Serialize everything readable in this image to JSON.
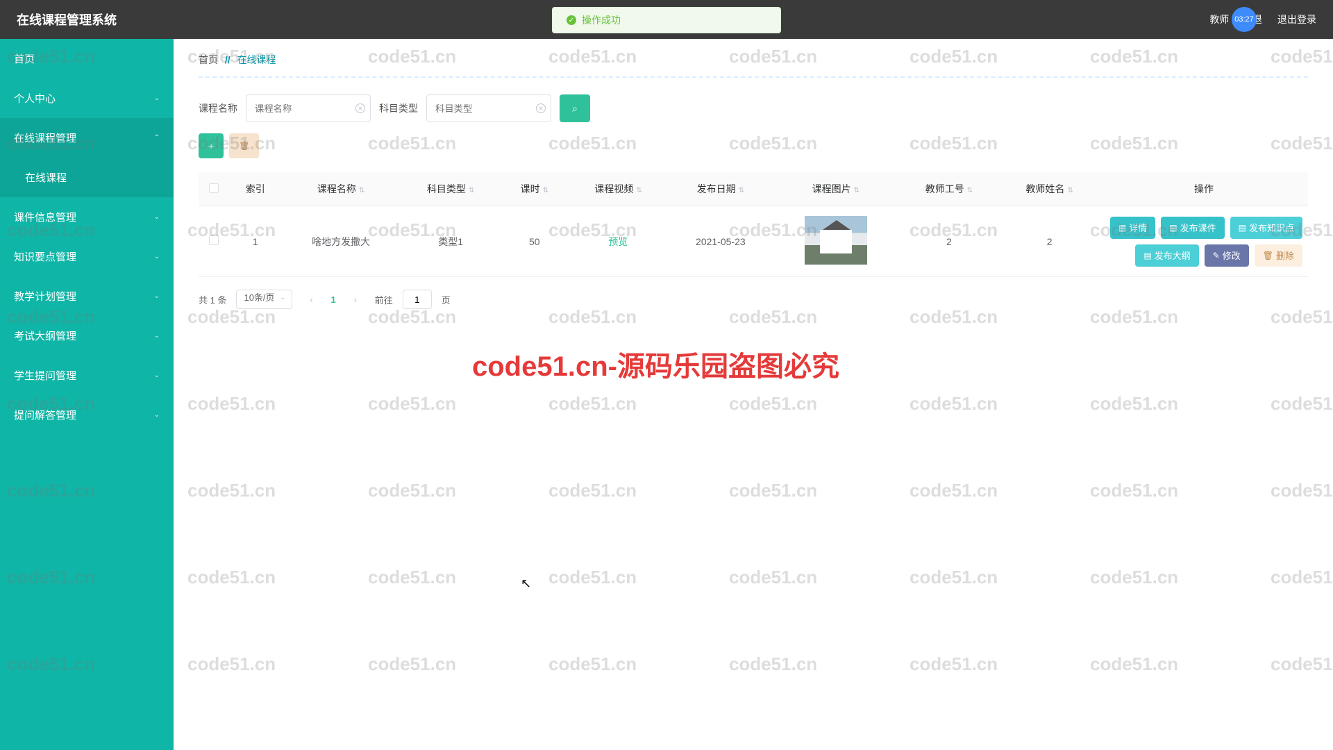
{
  "topbar": {
    "brand": "在线课程管理系统",
    "user": "教师 2",
    "back": "退",
    "logout": "退出登录",
    "time_badge": "03:27"
  },
  "toast": {
    "text": "操作成功"
  },
  "sidebar": {
    "items": [
      {
        "label": "首页",
        "expandable": false
      },
      {
        "label": "个人中心",
        "expandable": true
      },
      {
        "label": "在线课程管理",
        "expandable": true,
        "open": true
      },
      {
        "label": "在线课程",
        "child": true
      },
      {
        "label": "课件信息管理",
        "expandable": true
      },
      {
        "label": "知识要点管理",
        "expandable": true
      },
      {
        "label": "教学计划管理",
        "expandable": true
      },
      {
        "label": "考试大纲管理",
        "expandable": true
      },
      {
        "label": "学生提问管理",
        "expandable": true
      },
      {
        "label": "提问解答管理",
        "expandable": true
      }
    ]
  },
  "breadcrumb": {
    "home": "首页",
    "sep": "//",
    "current": "在线课程"
  },
  "filters": {
    "name_label": "课程名称",
    "name_placeholder": "课程名称",
    "type_label": "科目类型",
    "type_placeholder": "科目类型",
    "search_icon": "⌕"
  },
  "actions": {
    "add_icon": "+",
    "del_icon": "🗑"
  },
  "table": {
    "headers": [
      "",
      "索引",
      "课程名称",
      "科目类型",
      "课时",
      "课程视频",
      "发布日期",
      "课程图片",
      "教师工号",
      "教师姓名",
      "操作"
    ],
    "rows": [
      {
        "index": "1",
        "name": "啥地方发撒大",
        "type": "类型1",
        "hours": "50",
        "video": "预览",
        "date": "2021-05-23",
        "image": "house",
        "tid": "2",
        "tname": "2"
      }
    ],
    "ops": {
      "detail": "详情",
      "pub_courseware": "发布课件",
      "pub_knowledge": "发布知识点",
      "pub_outline": "发布大纲",
      "edit": "修改",
      "delete": "删除"
    }
  },
  "pager": {
    "total": "共 1 条",
    "page_size": "10条/页",
    "current": "1",
    "goto_prefix": "前往",
    "goto_value": "1",
    "goto_suffix": "页"
  },
  "watermark": {
    "small": "code51.cn",
    "big": "code51.cn-源码乐园盗图必究"
  }
}
